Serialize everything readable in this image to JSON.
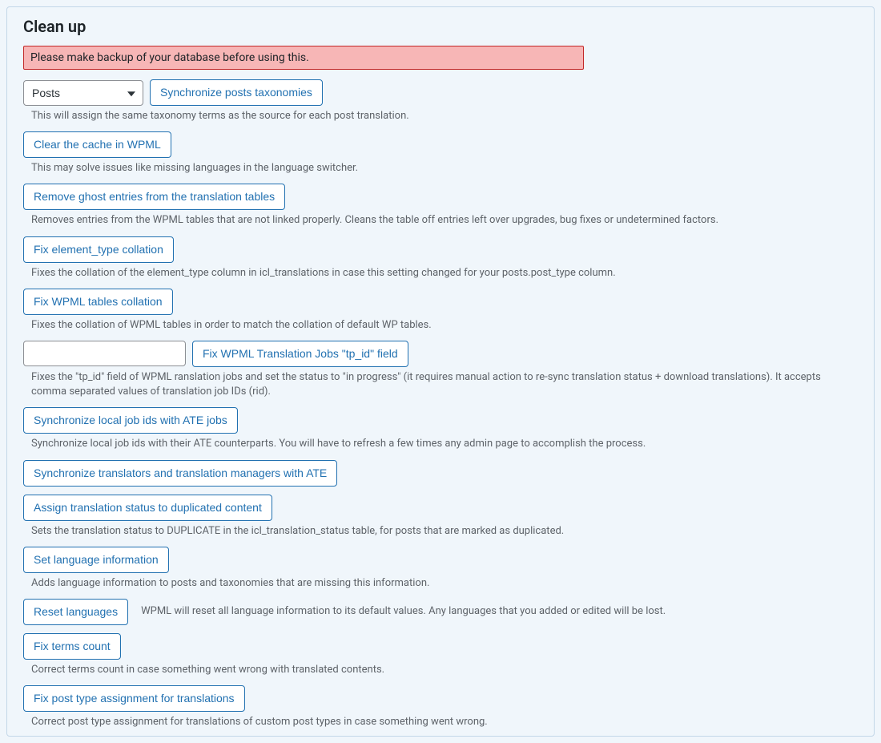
{
  "panel": {
    "title": "Clean up"
  },
  "warning": "Please make backup of your database before using this.",
  "postTypeSelect": {
    "value": "Posts"
  },
  "actions": {
    "syncTaxonomies": {
      "label": "Synchronize posts taxonomies",
      "description": "This will assign the same taxonomy terms as the source for each post translation."
    },
    "clearCache": {
      "label": "Clear the cache in WPML",
      "description": "This may solve issues like missing languages in the language switcher."
    },
    "removeGhost": {
      "label": "Remove ghost entries from the translation tables",
      "description": "Removes entries from the WPML tables that are not linked properly. Cleans the table off entries left over upgrades, bug fixes or undetermined factors."
    },
    "fixElementType": {
      "label": "Fix element_type collation",
      "description": "Fixes the collation of the element_type column in icl_translations in case this setting changed for your posts.post_type column."
    },
    "fixTablesCollation": {
      "label": "Fix WPML tables collation",
      "description": "Fixes the collation of WPML tables in order to match the collation of default WP tables."
    },
    "fixTpId": {
      "label": "Fix WPML Translation Jobs \"tp_id\" field",
      "description": "Fixes the \"tp_id\" field of WPML ranslation jobs and set the status to \"in progress\" (it requires manual action to re-sync translation status + download translations). It accepts comma separated values of translation job IDs (rid)."
    },
    "syncLocalJobs": {
      "label": "Synchronize local job ids with ATE jobs",
      "description": "Synchronize local job ids with their ATE counterparts. You will have to refresh a few times any admin page to accomplish the process."
    },
    "syncTranslators": {
      "label": "Synchronize translators and translation managers with ATE"
    },
    "assignDuplicate": {
      "label": "Assign translation status to duplicated content",
      "description": "Sets the translation status to DUPLICATE in the icl_translation_status table, for posts that are marked as duplicated."
    },
    "setLangInfo": {
      "label": "Set language information",
      "description": "Adds language information to posts and taxonomies that are missing this information."
    },
    "resetLanguages": {
      "label": "Reset languages",
      "description": "WPML will reset all language information to its default values. Any languages that you added or edited will be lost."
    },
    "fixTermsCount": {
      "label": "Fix terms count",
      "description": "Correct terms count in case something went wrong with translated contents."
    },
    "fixPostType": {
      "label": "Fix post type assignment for translations",
      "description": "Correct post type assignment for translations of custom post types in case something went wrong."
    }
  }
}
